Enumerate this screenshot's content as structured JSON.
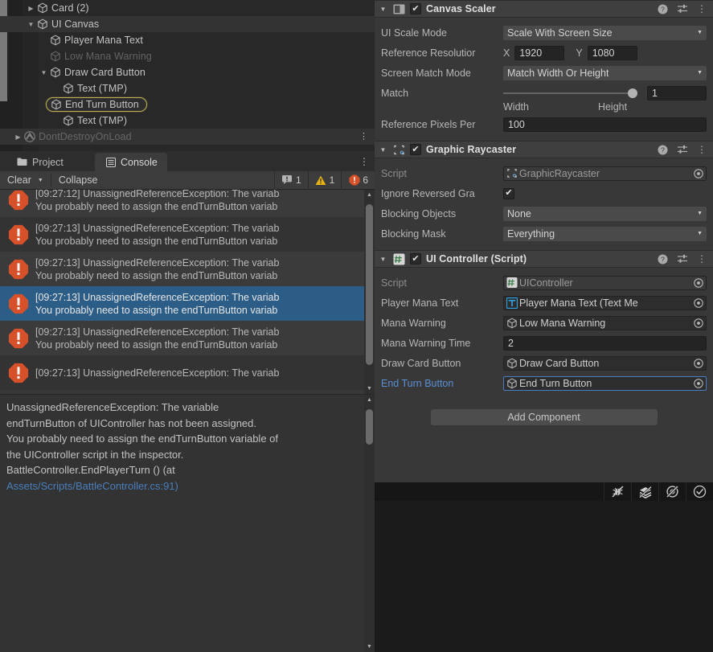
{
  "hierarchy": {
    "rows": [
      {
        "label": "Card (2)",
        "indent": 2,
        "twirl": "right",
        "dim": false,
        "selected": false,
        "highlight": false,
        "icon": "cube-icon"
      },
      {
        "label": "UI Canvas",
        "indent": 2,
        "twirl": "down",
        "dim": false,
        "selected": false,
        "highlight": true,
        "icon": "cube-icon"
      },
      {
        "label": "Player Mana Text",
        "indent": 3,
        "twirl": "none",
        "dim": false,
        "selected": false,
        "highlight": false,
        "icon": "cube-icon"
      },
      {
        "label": "Low Mana Warning",
        "indent": 3,
        "twirl": "none",
        "dim": true,
        "selected": false,
        "highlight": false,
        "icon": "cube-icon"
      },
      {
        "label": "Draw Card Button",
        "indent": 3,
        "twirl": "down",
        "dim": false,
        "selected": false,
        "highlight": false,
        "icon": "cube-icon"
      },
      {
        "label": "Text (TMP)",
        "indent": 4,
        "twirl": "none",
        "dim": false,
        "selected": false,
        "highlight": false,
        "icon": "cube-icon"
      },
      {
        "label": "End Turn Button",
        "indent": 3,
        "twirl": "none",
        "dim": false,
        "selected": true,
        "highlight": false,
        "icon": "cube-icon"
      },
      {
        "label": "Text (TMP)",
        "indent": 4,
        "twirl": "none",
        "dim": false,
        "selected": false,
        "highlight": false,
        "icon": "cube-icon"
      },
      {
        "label": "DontDestroyOnLoad",
        "indent": 1,
        "twirl": "right",
        "dim": true,
        "selected": false,
        "highlight": true,
        "icon": "unity-scene-icon"
      }
    ],
    "selection_outline_color": "#b9ad55"
  },
  "console": {
    "tabs": [
      {
        "label": "Project",
        "icon": "folder-icon",
        "active": false
      },
      {
        "label": "Console",
        "icon": "console-icon",
        "active": true
      }
    ],
    "toolbar": {
      "clear_label": "Clear",
      "collapse_label": "Collapse",
      "counts": [
        {
          "type": "info",
          "icon": "info-bubble-icon",
          "value": "1",
          "color": "#b0b0b0"
        },
        {
          "type": "warning",
          "icon": "warning-triangle-icon",
          "value": "1",
          "color": "#e8b411"
        },
        {
          "type": "error",
          "icon": "error-octagon-icon",
          "value": "6",
          "color": "#d6502a"
        }
      ]
    },
    "entries": [
      {
        "line1": "[09:27:12] UnassignedReferenceException: The variab",
        "line2": "You probably need to assign the endTurnButton variab",
        "selected": false,
        "icon": "error-octagon-icon"
      },
      {
        "line1": "[09:27:13] UnassignedReferenceException: The variab",
        "line2": "You probably need to assign the endTurnButton variab",
        "selected": false,
        "icon": "error-octagon-icon"
      },
      {
        "line1": "[09:27:13] UnassignedReferenceException: The variab",
        "line2": "You probably need to assign the endTurnButton variab",
        "selected": false,
        "icon": "error-octagon-icon"
      },
      {
        "line1": "[09:27:13] UnassignedReferenceException: The variab",
        "line2": "You probably need to assign the endTurnButton variab",
        "selected": true,
        "icon": "error-octagon-icon"
      },
      {
        "line1": "[09:27:13] UnassignedReferenceException: The variab",
        "line2": "You probably need to assign the endTurnButton variab",
        "selected": false,
        "icon": "error-octagon-icon"
      },
      {
        "line1": "[09:27:13] UnassignedReferenceException: The variab",
        "line2": "",
        "selected": false,
        "icon": "error-octagon-icon"
      }
    ],
    "selection_color": "#2c5d87",
    "detail_lines": [
      {
        "text": "UnassignedReferenceException: The variable",
        "link": false
      },
      {
        "text": "endTurnButton of UIController has not been assigned.",
        "link": false
      },
      {
        "text": "You probably need to assign the endTurnButton variable of",
        "link": false
      },
      {
        "text": "the UIController script in the inspector.",
        "link": false
      },
      {
        "text": "BattleController.EndPlayerTurn () (at",
        "link": false
      },
      {
        "text": "Assets/Scripts/BattleController.cs:91)",
        "link": true
      }
    ],
    "link_color": "#4a7ebb"
  },
  "inspector": {
    "components": [
      {
        "title": "Canvas Scaler",
        "icon": "canvas-scaler-icon",
        "enabled": true,
        "folded": false,
        "fields": [
          {
            "kind": "dropdown",
            "label": "UI Scale Mode",
            "value": "Scale With Screen Size"
          },
          {
            "kind": "vector2",
            "label": "Reference Resolutior",
            "x_label": "X",
            "x_value": "1920",
            "y_label": "Y",
            "y_value": "1080"
          },
          {
            "kind": "dropdown",
            "label": "Screen Match Mode",
            "value": "Match Width Or Height"
          },
          {
            "kind": "slider",
            "label": "Match",
            "value": "1",
            "min_label": "Width",
            "max_label": "Height",
            "fill": 1.0
          },
          {
            "kind": "number",
            "label": "Reference Pixels Per",
            "value": "100"
          }
        ]
      },
      {
        "title": "Graphic Raycaster",
        "icon": "raycaster-icon",
        "enabled": true,
        "folded": false,
        "fields": [
          {
            "kind": "object",
            "label": "Script",
            "value": "GraphicRaycaster",
            "label_dim": true,
            "field_dim": true,
            "icon": "raycaster-icon"
          },
          {
            "kind": "checkbox",
            "label": "Ignore Reversed Gra",
            "checked": true
          },
          {
            "kind": "dropdown",
            "label": "Blocking Objects",
            "value": "None"
          },
          {
            "kind": "dropdown",
            "label": "Blocking Mask",
            "value": "Everything"
          }
        ]
      },
      {
        "title": "UI Controller (Script)",
        "icon": "cs-script-icon",
        "enabled": true,
        "folded": false,
        "fields": [
          {
            "kind": "object",
            "label": "Script",
            "value": "UIController",
            "label_dim": true,
            "field_dim": true,
            "icon": "cs-script-icon"
          },
          {
            "kind": "object",
            "label": "Player Mana Text",
            "value": "Player Mana Text (Text Me",
            "icon": "tmp-text-icon"
          },
          {
            "kind": "object",
            "label": "Mana Warning",
            "value": "Low Mana Warning",
            "icon": "cube-icon"
          },
          {
            "kind": "number",
            "label": "Mana Warning Time",
            "value": "2"
          },
          {
            "kind": "object",
            "label": "Draw Card Button",
            "value": "Draw Card Button",
            "icon": "cube-icon"
          },
          {
            "kind": "object",
            "label": "End Turn Button",
            "value": "End Turn Button",
            "icon": "cube-icon",
            "label_blue": true,
            "focused": true
          }
        ]
      }
    ],
    "add_component_label": "Add Component"
  },
  "statusbar": {
    "icons": [
      {
        "name": "debug-bug-disabled-icon"
      },
      {
        "name": "layers-disabled-icon"
      },
      {
        "name": "preview-disabled-icon"
      },
      {
        "name": "check-circle-icon"
      }
    ]
  }
}
